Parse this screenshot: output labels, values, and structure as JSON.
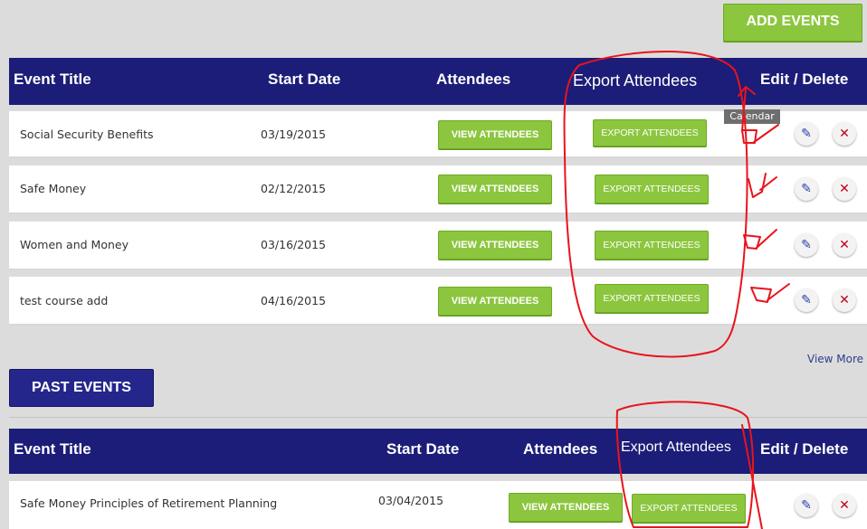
{
  "toolbar": {
    "add_events_label": "ADD EVENTS"
  },
  "upcoming": {
    "headers": {
      "title": "Event Title",
      "start": "Start Date",
      "attendees": "Attendees",
      "export": "Export Attendees",
      "edit_delete": "Edit / Delete"
    },
    "rows": [
      {
        "title": "Social Security Benefits",
        "date": "03/19/2015",
        "view": "VIEW ATTENDEES",
        "export": "EXPORT ATTENDEES"
      },
      {
        "title": "Safe Money",
        "date": "02/12/2015",
        "view": "VIEW ATTENDEES",
        "export": "EXPORT ATTENDEES"
      },
      {
        "title": "Women and Money",
        "date": "03/16/2015",
        "view": "VIEW ATTENDEES",
        "export": "EXPORT ATTENDEES"
      },
      {
        "title": "test course add",
        "date": "04/16/2015",
        "view": "VIEW ATTENDEES",
        "export": "EXPORT ATTENDEES"
      }
    ],
    "tooltip": "Calendar",
    "view_more": "View More"
  },
  "past": {
    "button_label": "PAST EVENTS",
    "headers": {
      "title": "Event Title",
      "start": "Start Date",
      "attendees": "Attendees",
      "export": "Export Attendees",
      "edit_delete": "Edit / Delete"
    },
    "rows": [
      {
        "title": "Safe Money Principles of Retirement Planning",
        "date": "03/04/2015",
        "view": "VIEW ATTENDEES",
        "export": "EXPORT ATTENDEES"
      }
    ]
  },
  "icons": {
    "edit": "pencil-icon",
    "delete": "close-icon"
  },
  "colors": {
    "header_bg": "#1c1d78",
    "button_green": "#8cc63f",
    "annotation_red": "#e8141c"
  }
}
